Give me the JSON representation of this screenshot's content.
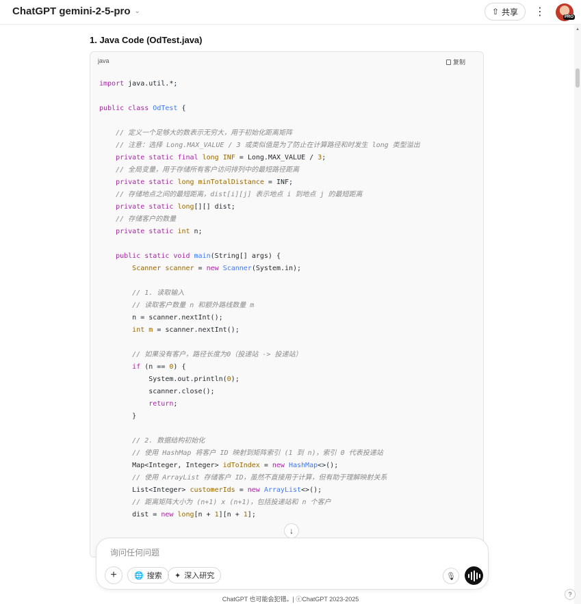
{
  "header": {
    "model_name": "ChatGPT gemini-2-5-pro",
    "chevron_icon": "chevron-down-icon",
    "share_label": "共享",
    "more_icon": "more-vertical-icon",
    "pro_badge": "PRO"
  },
  "main": {
    "section_title": "1. Java Code (OdTest.java)",
    "code_block": {
      "language": "java",
      "copy_label": "复制",
      "lines": [
        [
          {
            "t": "import",
            "c": "kw"
          },
          {
            "t": " java.util.*;"
          }
        ],
        [],
        [
          {
            "t": "public",
            "c": "kw"
          },
          {
            "t": " "
          },
          {
            "t": "class",
            "c": "kw"
          },
          {
            "t": " "
          },
          {
            "t": "OdTest",
            "c": "fn"
          },
          {
            "t": " {"
          }
        ],
        [],
        [
          {
            "t": "    // 定义一个足够大的数表示无穷大，用于初始化距离矩阵",
            "c": "cm"
          }
        ],
        [
          {
            "t": "    // 注意：选择 Long.MAX_VALUE / 3 或类似值是为了防止在计算路径和时发生 long 类型溢出",
            "c": "cm"
          }
        ],
        [
          {
            "t": "    "
          },
          {
            "t": "private",
            "c": "kw"
          },
          {
            "t": " "
          },
          {
            "t": "static",
            "c": "kw"
          },
          {
            "t": " "
          },
          {
            "t": "final",
            "c": "kw"
          },
          {
            "t": " "
          },
          {
            "t": "long",
            "c": "ty"
          },
          {
            "t": " "
          },
          {
            "t": "INF",
            "c": "ty"
          },
          {
            "t": " = Long.MAX_VALUE / "
          },
          {
            "t": "3",
            "c": "nm"
          },
          {
            "t": ";"
          }
        ],
        [
          {
            "t": "    // 全局变量，用于存储所有客户访问排列中的最短路径距离",
            "c": "cm"
          }
        ],
        [
          {
            "t": "    "
          },
          {
            "t": "private",
            "c": "kw"
          },
          {
            "t": " "
          },
          {
            "t": "static",
            "c": "kw"
          },
          {
            "t": " "
          },
          {
            "t": "long",
            "c": "ty"
          },
          {
            "t": " "
          },
          {
            "t": "minTotalDistance",
            "c": "ty"
          },
          {
            "t": " = INF;"
          }
        ],
        [
          {
            "t": "    // 存储地点之间的最短距离，dist[i][j] 表示地点 i 到地点 j 的最短距离",
            "c": "cm"
          }
        ],
        [
          {
            "t": "    "
          },
          {
            "t": "private",
            "c": "kw"
          },
          {
            "t": " "
          },
          {
            "t": "static",
            "c": "kw"
          },
          {
            "t": " "
          },
          {
            "t": "long",
            "c": "ty"
          },
          {
            "t": "[][] dist;"
          }
        ],
        [
          {
            "t": "    // 存储客户的数量",
            "c": "cm"
          }
        ],
        [
          {
            "t": "    "
          },
          {
            "t": "private",
            "c": "kw"
          },
          {
            "t": " "
          },
          {
            "t": "static",
            "c": "kw"
          },
          {
            "t": " "
          },
          {
            "t": "int",
            "c": "ty"
          },
          {
            "t": " n;"
          }
        ],
        [],
        [
          {
            "t": "    "
          },
          {
            "t": "public",
            "c": "kw"
          },
          {
            "t": " "
          },
          {
            "t": "static",
            "c": "kw"
          },
          {
            "t": " "
          },
          {
            "t": "void",
            "c": "kw"
          },
          {
            "t": " "
          },
          {
            "t": "main",
            "c": "fn"
          },
          {
            "t": "(String[] args) {"
          }
        ],
        [
          {
            "t": "        "
          },
          {
            "t": "Scanner",
            "c": "ty"
          },
          {
            "t": " "
          },
          {
            "t": "scanner",
            "c": "ty"
          },
          {
            "t": " = "
          },
          {
            "t": "new",
            "c": "kw"
          },
          {
            "t": " "
          },
          {
            "t": "Scanner",
            "c": "fn"
          },
          {
            "t": "(System.in);"
          }
        ],
        [],
        [
          {
            "t": "        // 1. 读取输入",
            "c": "cm"
          }
        ],
        [
          {
            "t": "        // 读取客户数量 n 和额外路线数量 m",
            "c": "cm"
          }
        ],
        [
          {
            "t": "        n = scanner.nextInt();"
          }
        ],
        [
          {
            "t": "        "
          },
          {
            "t": "int",
            "c": "ty"
          },
          {
            "t": " "
          },
          {
            "t": "m",
            "c": "ty"
          },
          {
            "t": " = scanner.nextInt();"
          }
        ],
        [],
        [
          {
            "t": "        // 如果没有客户，路径长度为0（投递站 -> 投递站）",
            "c": "cm"
          }
        ],
        [
          {
            "t": "        "
          },
          {
            "t": "if",
            "c": "kw"
          },
          {
            "t": " (n == "
          },
          {
            "t": "0",
            "c": "nm"
          },
          {
            "t": ") {"
          }
        ],
        [
          {
            "t": "            System.out.println("
          },
          {
            "t": "0",
            "c": "nm"
          },
          {
            "t": ");"
          }
        ],
        [
          {
            "t": "            scanner.close();"
          }
        ],
        [
          {
            "t": "            "
          },
          {
            "t": "return",
            "c": "kw"
          },
          {
            "t": ";"
          }
        ],
        [
          {
            "t": "        }"
          }
        ],
        [],
        [
          {
            "t": "        // 2. 数据结构初始化",
            "c": "cm"
          }
        ],
        [
          {
            "t": "        // 使用 HashMap 将客户 ID 映射到矩阵索引 (1 到 n)，索引 0 代表投递站",
            "c": "cm"
          }
        ],
        [
          {
            "t": "        Map<Integer, Integer> "
          },
          {
            "t": "idToIndex",
            "c": "ty"
          },
          {
            "t": " = "
          },
          {
            "t": "new",
            "c": "kw"
          },
          {
            "t": " "
          },
          {
            "t": "HashMap",
            "c": "fn"
          },
          {
            "t": "<>();"
          }
        ],
        [
          {
            "t": "        // 使用 ArrayList 存储客户 ID，虽然不直接用于计算，但有助于理解映射关系",
            "c": "cm"
          }
        ],
        [
          {
            "t": "        List<Integer> "
          },
          {
            "t": "customerIds",
            "c": "ty"
          },
          {
            "t": " = "
          },
          {
            "t": "new",
            "c": "kw"
          },
          {
            "t": " "
          },
          {
            "t": "ArrayList",
            "c": "fn"
          },
          {
            "t": "<>();"
          }
        ],
        [
          {
            "t": "        // 距离矩阵大小为 (n+1) x (n+1)，包括投递站和 n 个客户",
            "c": "cm"
          }
        ],
        [
          {
            "t": "        dist = "
          },
          {
            "t": "new",
            "c": "kw"
          },
          {
            "t": " "
          },
          {
            "t": "long",
            "c": "ty"
          },
          {
            "t": "[n + "
          },
          {
            "t": "1",
            "c": "nm"
          },
          {
            "t": "][n + "
          },
          {
            "t": "1",
            "c": "nm"
          },
          {
            "t": "];"
          }
        ]
      ]
    },
    "scroll_down_icon": "arrow-down-icon"
  },
  "composer": {
    "placeholder": "询问任何问题",
    "plus_icon": "plus-icon",
    "search_label": "搜索",
    "search_icon": "globe-icon",
    "research_label": "深入研究",
    "research_icon": "telescope-icon",
    "mic_icon": "mic-icon",
    "voice_icon": "voice-waveform-icon"
  },
  "footer": {
    "text": "ChatGPT 也可能会犯错。| ⓒChatGPT 2023-2025",
    "help_label": "?"
  }
}
